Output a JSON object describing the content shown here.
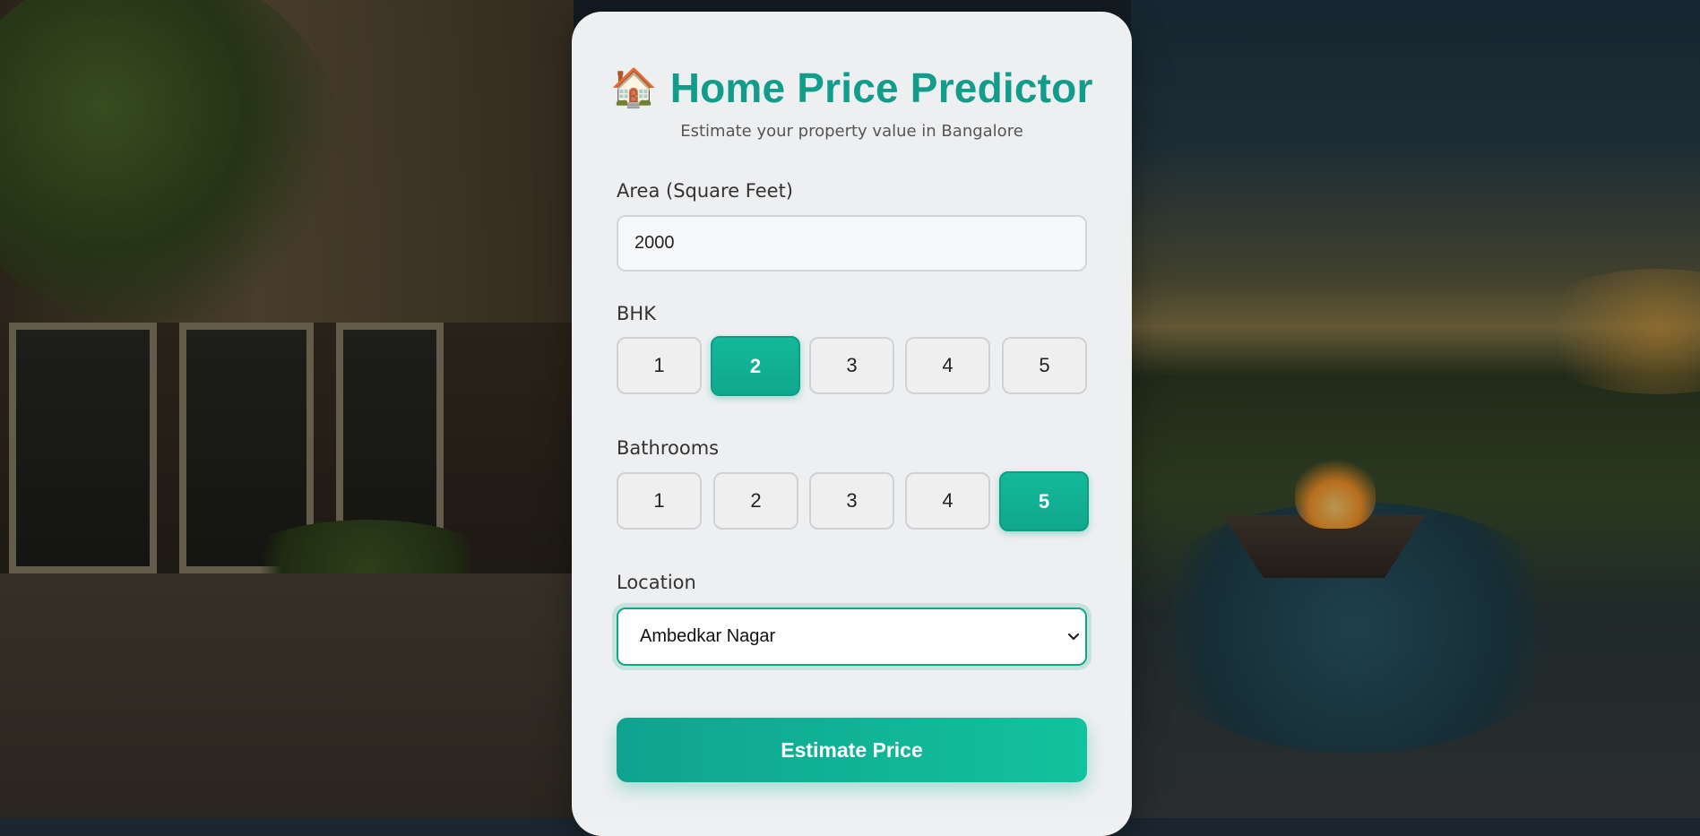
{
  "header": {
    "icon": "house-emoji",
    "icon_glyph": "🏠",
    "title": "Home Price Predictor",
    "subtitle": "Estimate your property value in Bangalore"
  },
  "area": {
    "label": "Area (Square Feet)",
    "value": "2000"
  },
  "bhk": {
    "label": "BHK",
    "options": [
      "1",
      "2",
      "3",
      "4",
      "5"
    ],
    "selected": "2"
  },
  "bathrooms": {
    "label": "Bathrooms",
    "options": [
      "1",
      "2",
      "3",
      "4",
      "5"
    ],
    "selected": "5"
  },
  "location": {
    "label": "Location",
    "selected": "Ambedkar Nagar",
    "icon": "chevron-down-icon"
  },
  "submit": {
    "label": "Estimate Price"
  },
  "colors": {
    "accent": "#129c8b",
    "button_gradient_start": "#0fa38f",
    "button_gradient_end": "#12c29d"
  }
}
